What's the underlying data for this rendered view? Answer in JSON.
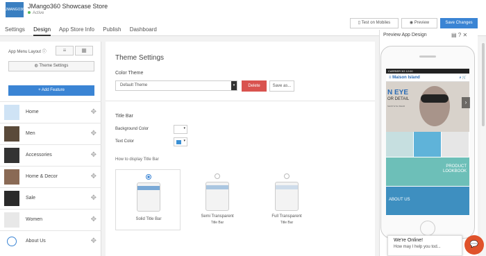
{
  "header": {
    "logo_text": "JMANGO360",
    "store_name": "JMango360 Showcase Store",
    "status": "Active",
    "tabs": [
      "Settings",
      "Design",
      "App Store Info",
      "Publish",
      "Dashboard"
    ],
    "active_tab": "Design",
    "btn_test": "Test on Mobiles",
    "btn_preview": "Preview",
    "btn_save": "Save Changes"
  },
  "sidebar": {
    "layout_label": "App Menu Layout",
    "theme_settings": "Theme Settings",
    "add_feature": "+ Add Feature",
    "items": [
      "Home",
      "Men",
      "Accessories",
      "Home & Decor",
      "Sale",
      "Women",
      "About Us"
    ]
  },
  "main": {
    "title": "Theme Settings",
    "color_theme_label": "Color Theme",
    "color_theme_value": "Default Theme",
    "delete": "Delete",
    "save_as": "Save as...",
    "title_bar": "Title Bar",
    "bg_color": "Background Color",
    "text_color": "Text Color",
    "display_q": "How to display Title Bar",
    "options": [
      {
        "line1": "Solid Title Bar",
        "line2": ""
      },
      {
        "line1": "Semi Transparent",
        "line2": "Title Bar"
      },
      {
        "line1": "Full Transparent",
        "line2": "Title Bar"
      }
    ],
    "selected_option": 0,
    "colors": {
      "bg": "#ffffff",
      "text": "#3a8fd4"
    }
  },
  "preview": {
    "title": "Preview App Design",
    "status_bar": "CARRIER  3G          12:00",
    "app_name": "Maison Island",
    "hero_big": "N EYE",
    "hero_sub": "OR DETAIL",
    "hero_small": "SHOP EYE WEAR",
    "banner1": "PRODUCT\nLOOKBOOK",
    "banner2": "ABOUT US"
  },
  "chat": {
    "title": "We're Online!",
    "subtitle": "How may I help you tod..."
  }
}
